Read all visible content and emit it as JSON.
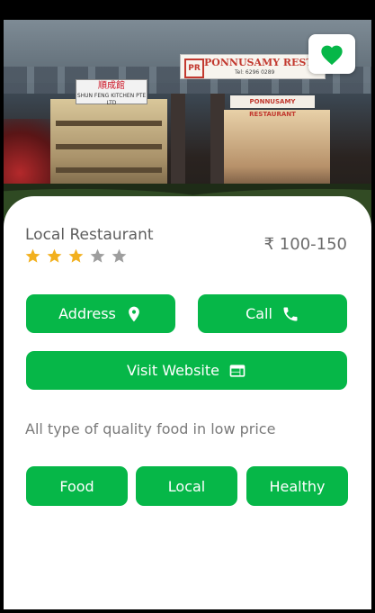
{
  "hero": {
    "sign_left_main": "順成館",
    "sign_left_sub": "SHUN FENG KITCHEN PTE LTD",
    "sign_right_logo": "PR",
    "sign_right_name": "PONNUSAMY RESTAU",
    "sign_right_tel": "Tel: 6296 0289",
    "sign_mid": "PONNUSAMY RESTAURANT"
  },
  "restaurant": {
    "name": "Local Restaurant",
    "price_range": "₹ 100-150",
    "rating": 3,
    "rating_max": 5,
    "description": "All type of quality food in low price"
  },
  "actions": {
    "address_label": "Address",
    "call_label": "Call",
    "website_label": "Visit Website"
  },
  "tags": [
    "Food",
    "Local",
    "Healthy"
  ],
  "colors": {
    "accent": "#06b748",
    "star_filled": "#f2b01e",
    "star_empty": "#9e9e9e"
  },
  "icons": {
    "favorite": "heart-icon",
    "address": "location-pin-icon",
    "call": "phone-icon",
    "website": "web-window-icon",
    "rating": "star-icon"
  }
}
